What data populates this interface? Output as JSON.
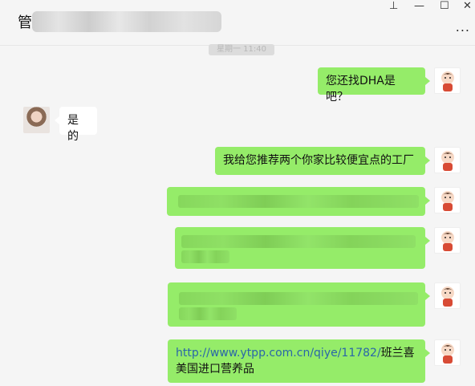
{
  "header": {
    "title_first_char": "管",
    "controls": [
      "⊥",
      "—",
      "☐",
      "✕"
    ],
    "more": "..."
  },
  "timestamp": "星期一 11:40",
  "messages": [
    {
      "side": "right",
      "text": "您还找DHA是吧？"
    },
    {
      "side": "left",
      "text": "是的"
    },
    {
      "side": "right",
      "text": "我给您推荐两个你家比较便宜点的工厂"
    },
    {
      "side": "right",
      "text": ""
    },
    {
      "side": "right",
      "text": ""
    },
    {
      "side": "right",
      "text": ""
    },
    {
      "side": "right",
      "link": "http://www.ytpp.com.cn/qiye/11782/",
      "text": "班兰喜美国进口营养品"
    }
  ],
  "colors": {
    "bubble_green": "#95ec69",
    "bubble_white": "#ffffff",
    "background": "#f5f5f5",
    "link": "#2a66a8"
  }
}
